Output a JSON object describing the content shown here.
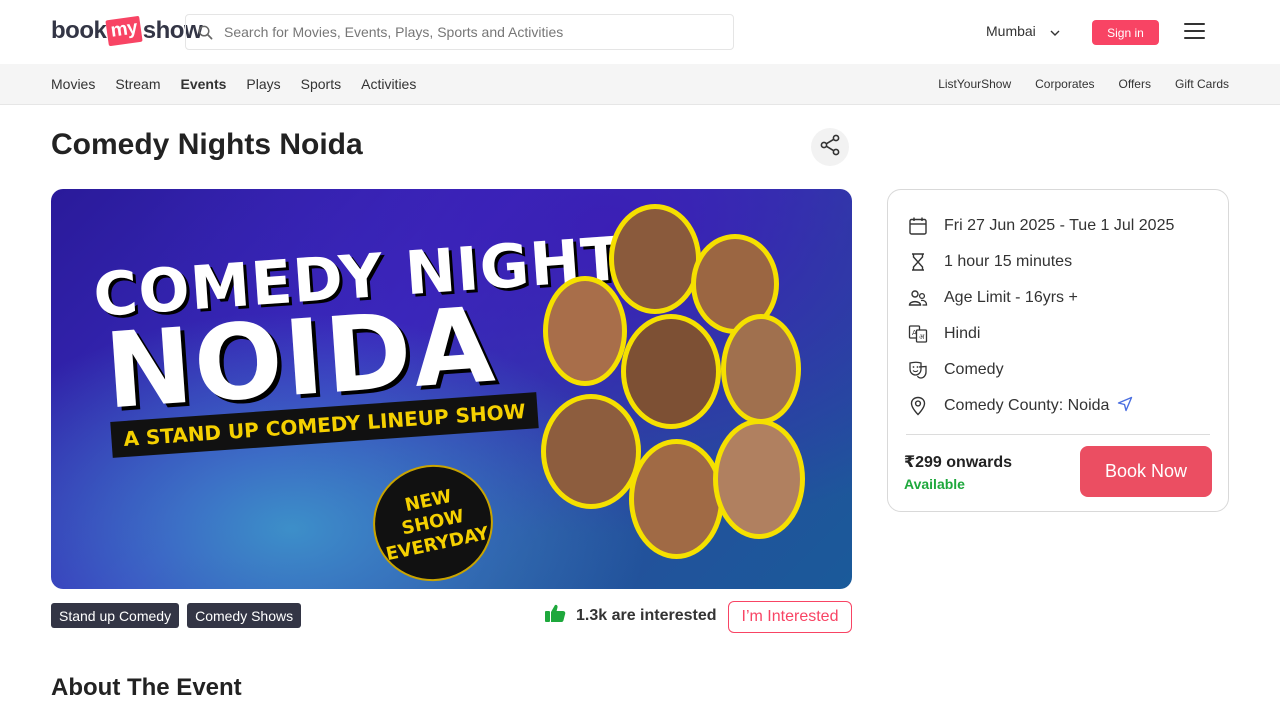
{
  "header": {
    "logo_text_1": "book",
    "logo_text_2": "my",
    "logo_text_3": "show",
    "search_placeholder": "Search for Movies, Events, Plays, Sports and Activities",
    "city": "Mumbai",
    "signin_label": "Sign in"
  },
  "nav": {
    "left": [
      "Movies",
      "Stream",
      "Events",
      "Plays",
      "Sports",
      "Activities"
    ],
    "active": "Events",
    "right": [
      "ListYourShow",
      "Corporates",
      "Offers",
      "Gift Cards"
    ]
  },
  "event": {
    "title": "Comedy Nights Noida",
    "banner": {
      "line1": "COMEDY NIGHTS",
      "line2": "NOIDA",
      "line3": "A STAND UP COMEDY LINEUP SHOW",
      "badge": "NEW SHOW EVERYDAY"
    },
    "tags": [
      "Stand up Comedy",
      "Comedy Shows"
    ],
    "interested_count": "1.3k are interested",
    "interested_button": "I’m Interested",
    "about_heading": "About The Event"
  },
  "card": {
    "date": "Fri 27 Jun 2025 - Tue 1 Jul 2025",
    "duration": "1 hour 15 minutes",
    "age": "Age Limit - 16yrs +",
    "language": "Hindi",
    "genre": "Comedy",
    "venue": "Comedy County: Noida",
    "price": "₹299 onwards",
    "availability": "Available",
    "book_label": "Book Now"
  },
  "colors": {
    "brand": "#f84464",
    "tag_bg": "#333545",
    "available": "#1ea83c",
    "book_button": "#eb4e62"
  },
  "icons": {
    "date": "calendar-icon",
    "duration": "hourglass-icon",
    "age": "users-icon",
    "language": "translate-icon",
    "genre": "masks-icon",
    "venue": "location-pin-icon",
    "share": "share-icon"
  }
}
